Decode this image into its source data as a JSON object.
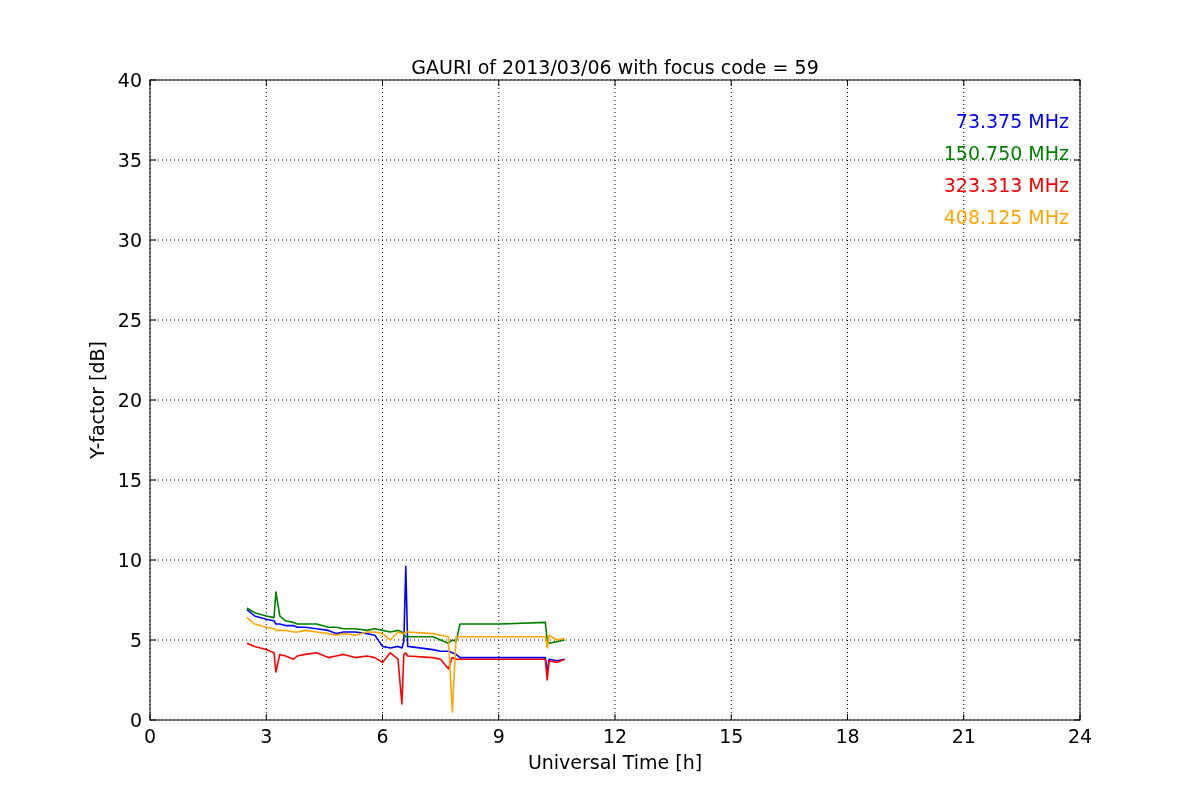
{
  "chart_data": {
    "type": "line",
    "grid": true,
    "title": "GAURI of 2013/03/06 with focus code = 59",
    "xlabel": "Universal Time [h]",
    "ylabel": "Y-factor [dB]",
    "xlim": [
      0,
      24
    ],
    "ylim": [
      0,
      40
    ],
    "xticks": [
      0,
      3,
      6,
      9,
      12,
      15,
      18,
      21,
      24
    ],
    "yticks": [
      0,
      5,
      10,
      15,
      20,
      25,
      30,
      35,
      40
    ],
    "x": [
      2.5,
      2.7,
      3.0,
      3.2,
      3.25,
      3.35,
      3.5,
      3.7,
      3.8,
      4.0,
      4.3,
      4.6,
      4.8,
      5.0,
      5.3,
      5.6,
      5.8,
      6.0,
      6.2,
      6.4,
      6.5,
      6.55,
      6.6,
      6.65,
      7.3,
      7.5,
      7.7,
      7.8,
      7.9,
      8.0,
      9.0,
      10.2,
      10.25,
      10.3,
      10.5,
      10.7
    ],
    "series": [
      {
        "name": "73.375 MHz",
        "color": "#0000ff",
        "values": [
          6.9,
          6.5,
          6.3,
          6.2,
          6.0,
          6.0,
          5.9,
          5.9,
          5.8,
          5.8,
          5.7,
          5.6,
          5.4,
          5.5,
          5.5,
          5.4,
          5.3,
          4.6,
          4.5,
          4.6,
          4.5,
          4.9,
          9.6,
          4.6,
          4.4,
          4.3,
          4.3,
          4.2,
          4.1,
          3.9,
          3.9,
          3.9,
          3.0,
          3.8,
          3.7,
          3.8
        ]
      },
      {
        "name": "150.750 MHz",
        "color": "#008000",
        "values": [
          7.0,
          6.7,
          6.5,
          6.4,
          8.0,
          6.5,
          6.2,
          6.1,
          6.0,
          6.0,
          6.0,
          5.8,
          5.8,
          5.7,
          5.7,
          5.6,
          5.7,
          5.6,
          5.5,
          5.6,
          5.5,
          5.4,
          5.2,
          5.2,
          5.2,
          5.0,
          4.8,
          5.0,
          4.9,
          6.0,
          6.0,
          6.1,
          5.0,
          4.8,
          4.9,
          5.0
        ]
      },
      {
        "name": "323.313 MHz",
        "color": "#ff0000",
        "values": [
          4.8,
          4.6,
          4.4,
          4.2,
          3.0,
          4.1,
          4.0,
          3.8,
          4.0,
          4.1,
          4.2,
          3.9,
          4.0,
          4.1,
          3.9,
          4.0,
          3.9,
          3.6,
          4.2,
          3.8,
          1.0,
          4.1,
          4.2,
          4.0,
          3.9,
          3.8,
          3.2,
          3.9,
          3.8,
          3.8,
          3.8,
          3.8,
          2.5,
          3.7,
          3.6,
          3.8
        ]
      },
      {
        "name": "408.125 MHz",
        "color": "#ffa500",
        "values": [
          6.4,
          6.0,
          5.8,
          5.7,
          5.6,
          5.6,
          5.6,
          5.5,
          5.5,
          5.6,
          5.5,
          5.4,
          5.3,
          5.4,
          5.3,
          5.5,
          5.5,
          5.4,
          5.0,
          5.5,
          5.4,
          5.4,
          5.5,
          5.5,
          5.4,
          5.3,
          5.2,
          0.5,
          5.2,
          5.2,
          5.2,
          5.2,
          4.5,
          5.3,
          5.0,
          5.1
        ]
      }
    ]
  }
}
